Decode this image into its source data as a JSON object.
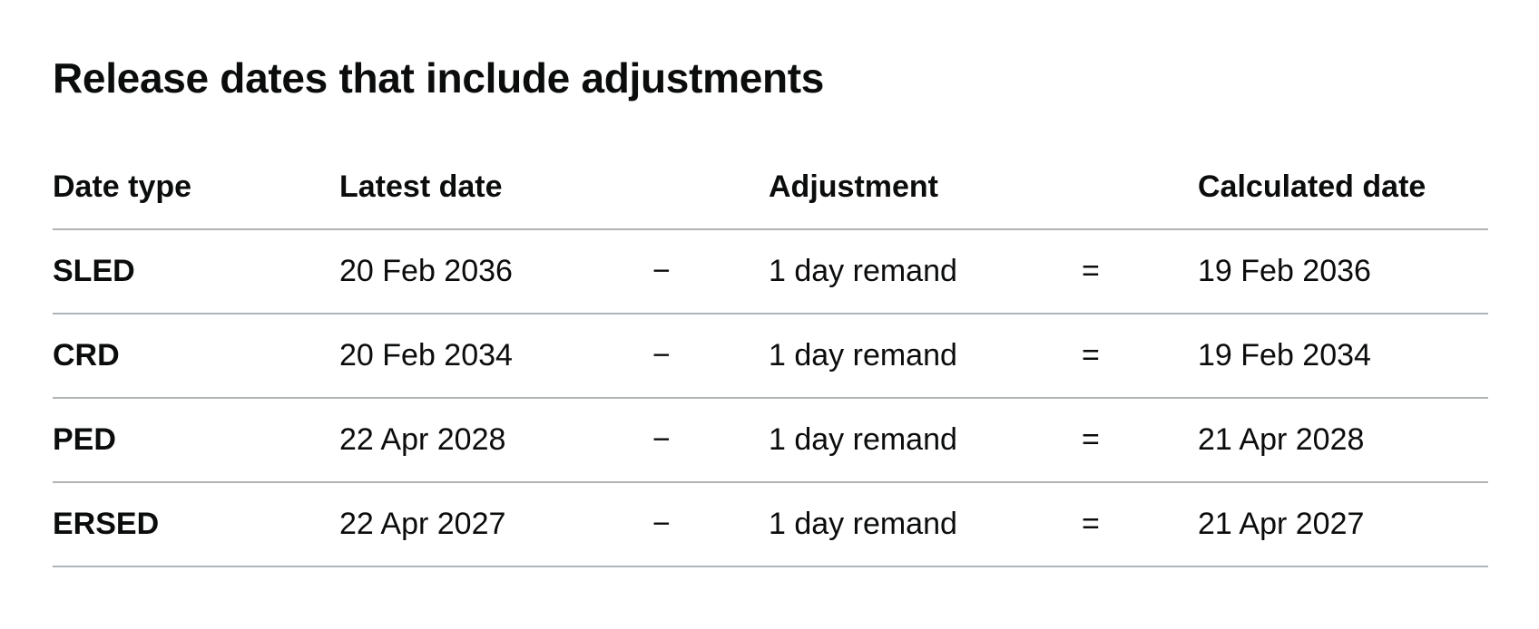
{
  "title": "Release dates that include adjustments",
  "table": {
    "headers": {
      "date_type": "Date type",
      "latest_date": "Latest date",
      "adjustment": "Adjustment",
      "calculated_date": "Calculated date"
    },
    "rows": [
      {
        "date_type": "SLED",
        "latest_date": "20 Feb 2036",
        "minus": "−",
        "adjustment": "1 day remand",
        "equals": "=",
        "calculated_date": "19 Feb 2036"
      },
      {
        "date_type": "CRD",
        "latest_date": "20 Feb 2034",
        "minus": "−",
        "adjustment": "1 day remand",
        "equals": "=",
        "calculated_date": "19 Feb 2034"
      },
      {
        "date_type": "PED",
        "latest_date": "22 Apr 2028",
        "minus": "−",
        "adjustment": "1 day remand",
        "equals": "=",
        "calculated_date": "21 Apr 2028"
      },
      {
        "date_type": "ERSED",
        "latest_date": "22 Apr 2027",
        "minus": "−",
        "adjustment": "1 day remand",
        "equals": "=",
        "calculated_date": "21 Apr 2027"
      }
    ]
  }
}
